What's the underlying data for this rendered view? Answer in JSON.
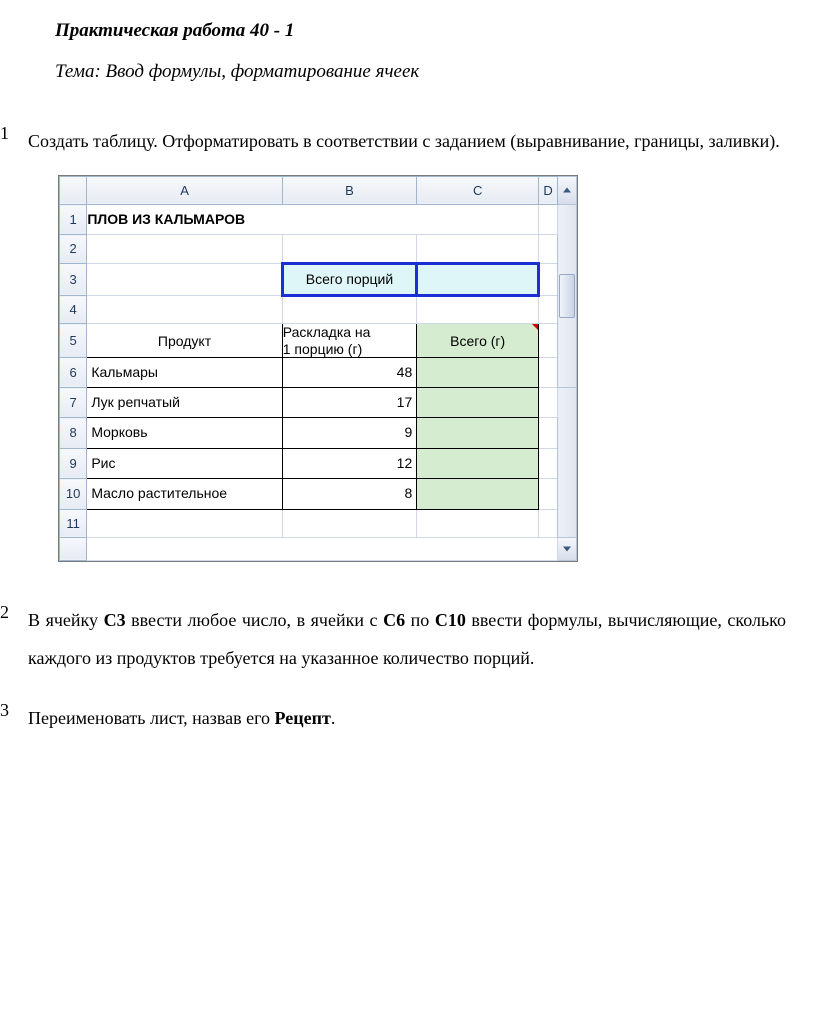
{
  "doc": {
    "title": "Практическая работа 40 - 1",
    "subtitle": "Тема: Ввод формулы, форматирование ячеек",
    "task1": "Создать таблицу. Отформатировать в соответствии с заданием (выравнивание, границы, заливки).",
    "task2_pre": "В ячейку ",
    "task2_c3": "С3",
    "task2_mid1": " ввести любое число, в ячейки с ",
    "task2_c6": "С6",
    "task2_mid2": " по ",
    "task2_c10": "С10",
    "task2_post": " ввести формулы, вычисляющие, сколько каждого из продуктов требуется на указанное количество порций.",
    "task3_pre": "Переименовать лист, назвав его ",
    "task3_bold": "Рецепт",
    "task3_post": ".",
    "num1": "1",
    "num2": "2",
    "num3": "3"
  },
  "sheet": {
    "cols": {
      "A": "A",
      "B": "B",
      "C": "C",
      "D": "D"
    },
    "rows": [
      "1",
      "2",
      "3",
      "4",
      "5",
      "6",
      "7",
      "8",
      "9",
      "10",
      "11"
    ],
    "A1": "ПЛОВ ИЗ КАЛЬМАРОВ",
    "B3": "Всего порций",
    "A5": "Продукт",
    "B5a": "Раскладка на",
    "B5b": "1 порцию (г)",
    "C5": "Всего (г)",
    "products": [
      {
        "name": "Кальмары",
        "val": "48"
      },
      {
        "name": "Лук репчатый",
        "val": "17"
      },
      {
        "name": "Морковь",
        "val": "9"
      },
      {
        "name": "Рис",
        "val": "12"
      },
      {
        "name": "Масло растительное",
        "val": "8"
      }
    ]
  }
}
